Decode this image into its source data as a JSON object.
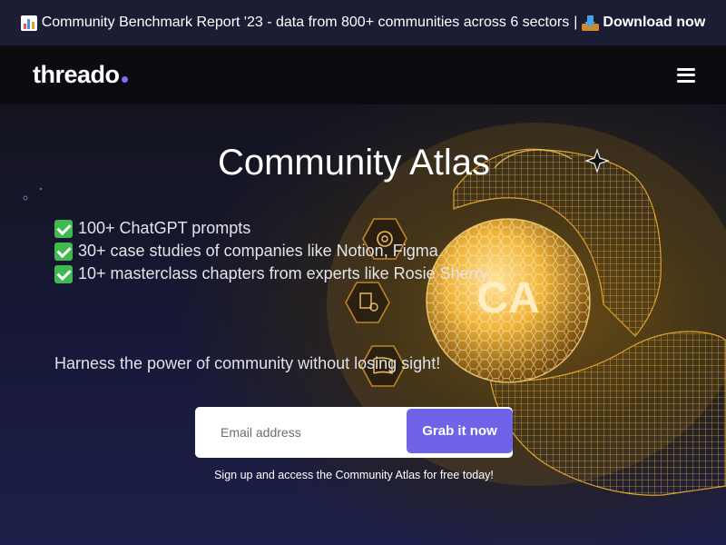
{
  "banner": {
    "chart_icon": "bar-chart-emoji-icon",
    "text": "Community Benchmark Report '23 - data from 800+ communities across 6 sectors",
    "separator": "|",
    "download_icon": "inbox-tray-emoji-icon",
    "download_label": "Download now"
  },
  "nav": {
    "logo_text": "threado",
    "menu_icon": "hamburger-menu-icon"
  },
  "hero": {
    "title": "Community Atlas",
    "features": [
      "100+ ChatGPT prompts",
      "30+ case studies of companies like Notion, Figma",
      "10+ masterclass chapters from experts like Rosie Sherry"
    ],
    "check_icon": "check-mark-emoji-icon",
    "tagline": "Harness the power of community without losing sight!",
    "orb_text": "CA",
    "email_placeholder": "Email address",
    "cta_label": "Grab it now",
    "subnote": "Sign up and access the Community Atlas for free today!"
  },
  "colors": {
    "banner_bg": "#1b1d35",
    "nav_bg": "#0b0b10",
    "accent": "#6f63e8",
    "gold": "#f0b43a"
  }
}
